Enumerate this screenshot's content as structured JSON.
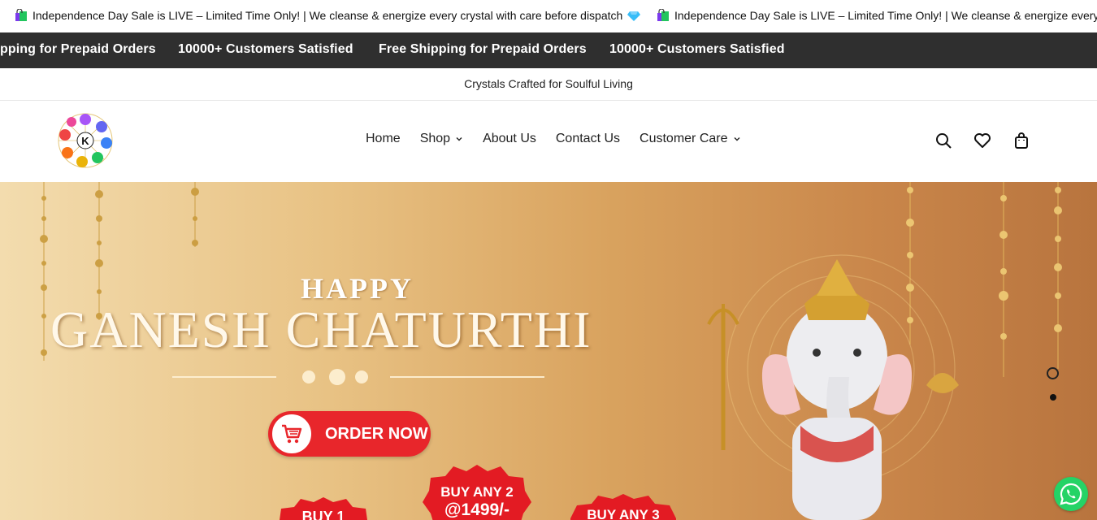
{
  "announcement": {
    "message": "Independence Day Sale is LIVE – Limited Time Only! | We cleanse & energize every crystal with care before dispatch",
    "message_repeat": "Independence Day Sale is LIVE – Limited Time Only! | We cleanse & energize every"
  },
  "strip": {
    "items": [
      "pping for Prepaid Orders",
      "10000+ Customers Satisfied",
      "Free Shipping for Prepaid Orders",
      "10000+ Customers Satisfied"
    ]
  },
  "tagline": "Crystals Crafted for Soulful Living",
  "nav": {
    "home": "Home",
    "shop": "Shop",
    "about": "About Us",
    "contact": "Contact Us",
    "care": "Customer Care"
  },
  "hero": {
    "happy": "HAPPY",
    "title": "GANESH CHATURTHI",
    "order_button": "ORDER NOW",
    "badge_left": "BUY 1",
    "badge_mid_line1": "BUY ANY 2",
    "badge_mid_line2": "@1499/-",
    "badge_right": "BUY ANY 3"
  },
  "colors": {
    "accent_red": "#e8262b",
    "strip_bg": "#2f2f2f",
    "whatsapp_green": "#25d366"
  }
}
